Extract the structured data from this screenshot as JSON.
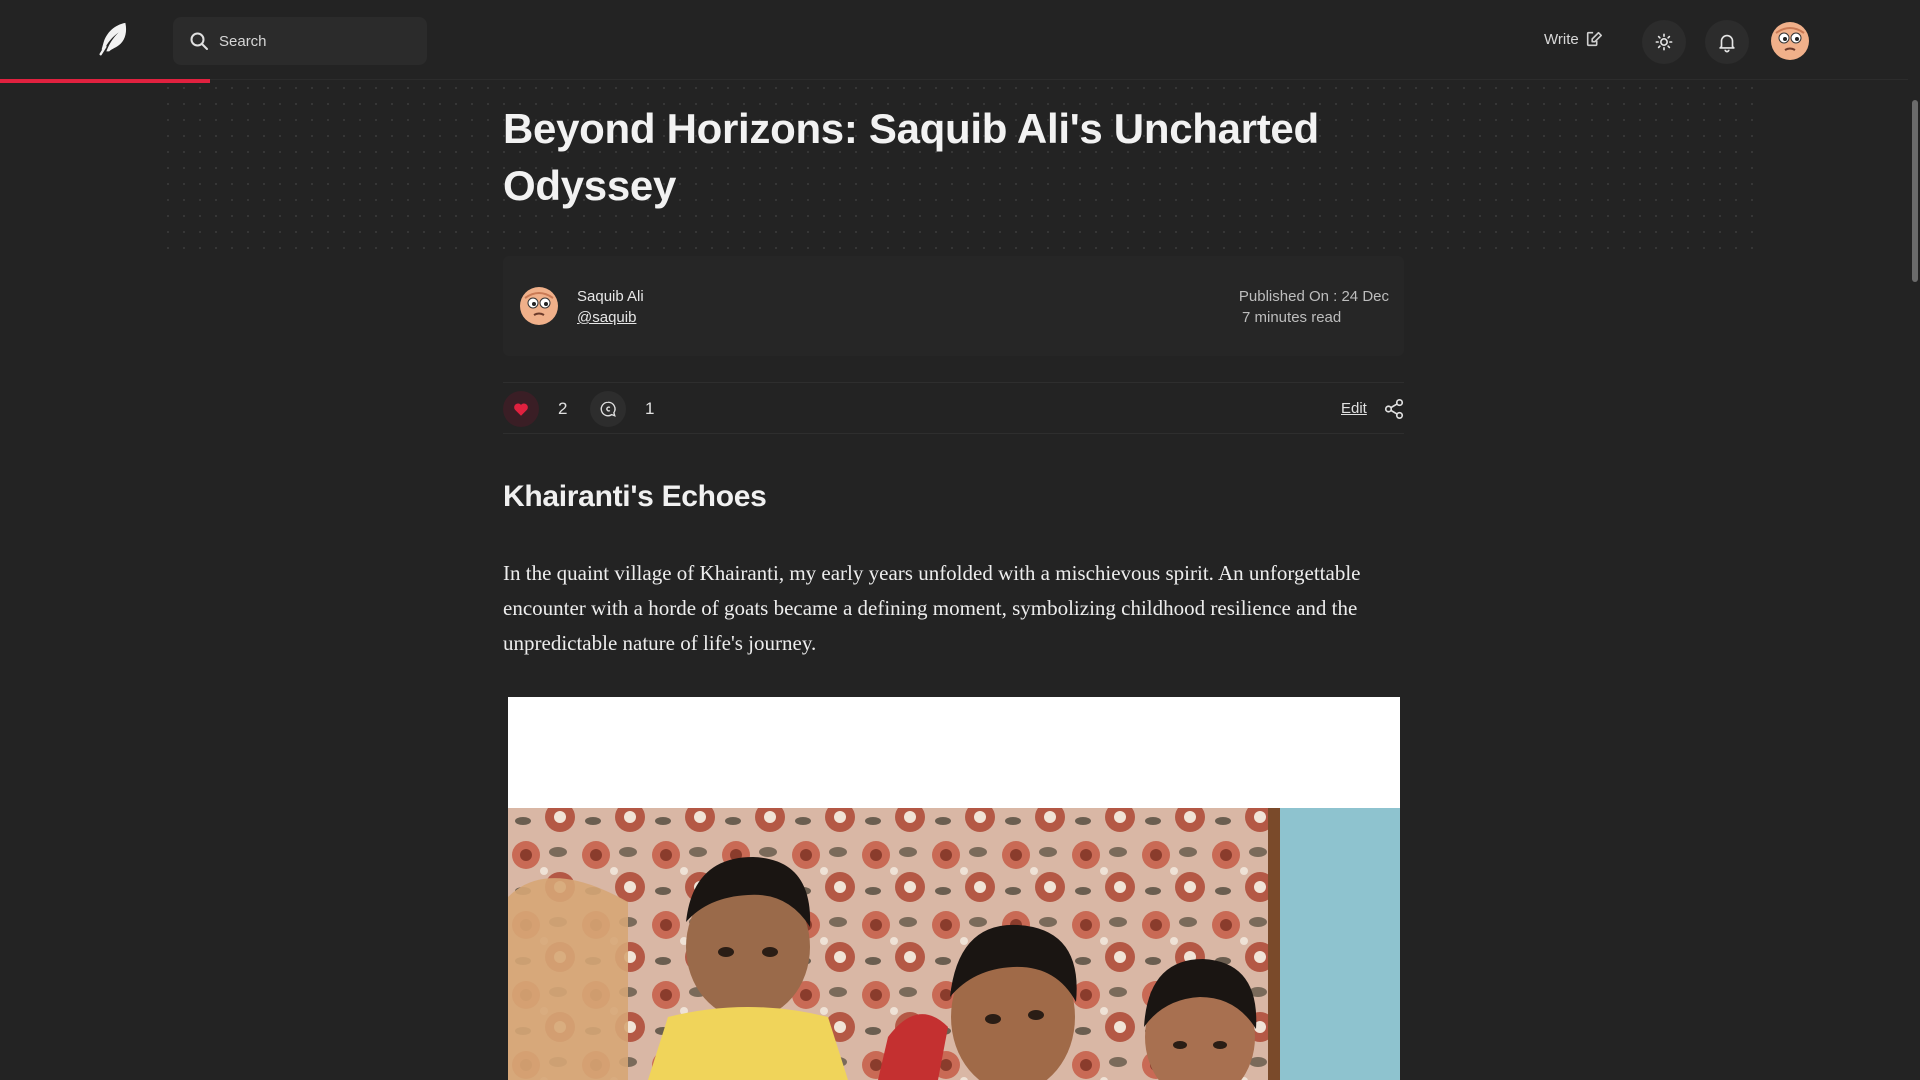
{
  "header": {
    "logo": "feather-logo-icon",
    "search_placeholder": "Search",
    "write_label": "Write",
    "theme_icon": "sun-icon",
    "notifications_icon": "bell-icon"
  },
  "reading_progress_percent": 11,
  "article": {
    "title": "Beyond Horizons: Saquib Ali's Uncharted Odyssey",
    "author_name": "Saquib Ali",
    "author_handle": "@saquib",
    "published": "Published On : 24 Dec",
    "read_time": "7 minutes read",
    "likes": "2",
    "comments": "1",
    "edit_label": "Edit",
    "section_heading": "Khairanti's Echoes",
    "paragraph": "In the quaint village of Khairanti, my early years unfolded with a mischievous spirit. An unforgettable encounter with a horde of goats became a defining moment, symbolizing childhood resilience and the unpredictable nature of life's journey."
  },
  "colors": {
    "background": "#232323",
    "accent": "#e0213f",
    "card": "#262626"
  }
}
